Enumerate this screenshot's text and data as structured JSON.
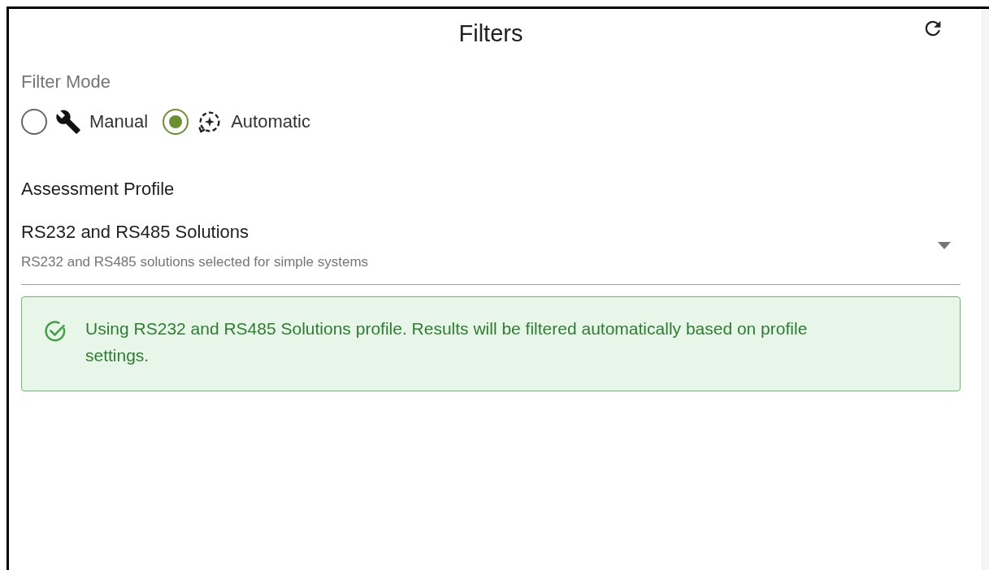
{
  "header": {
    "title": "Filters"
  },
  "filter_mode": {
    "label": "Filter Mode",
    "options": [
      {
        "kind": "manual",
        "label": "Manual",
        "selected": false
      },
      {
        "kind": "automatic",
        "label": "Automatic",
        "selected": true
      }
    ]
  },
  "assessment_profile": {
    "label": "Assessment Profile",
    "value": "RS232 and RS485 Solutions",
    "description": "RS232 and RS485 solutions selected for simple systems"
  },
  "alert": {
    "message": "Using RS232 and RS485 Solutions profile. Results will be filtered automatically based on profile settings."
  }
}
